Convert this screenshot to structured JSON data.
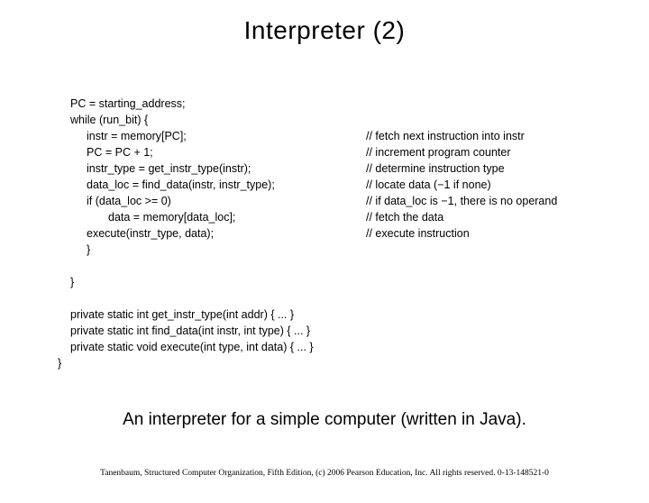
{
  "title": "Interpreter (2)",
  "code": {
    "l0": {
      "txt": "PC = starting_address;",
      "cmt": ""
    },
    "l1": {
      "txt": "while (run_bit) {",
      "cmt": ""
    },
    "l2": {
      "txt": "instr = memory[PC];",
      "cmt": "// fetch next instruction into instr"
    },
    "l3": {
      "txt": "PC = PC + 1;",
      "cmt": "// increment program counter"
    },
    "l4": {
      "txt": "instr_type = get_instr_type(instr);",
      "cmt": "// determine instruction type"
    },
    "l5": {
      "txt": "data_loc = find_data(instr, instr_type);",
      "cmt": "// locate data (−1 if none)"
    },
    "l6": {
      "txt": "if (data_loc >= 0)",
      "cmt": "// if data_loc is −1, there is no operand"
    },
    "l7": {
      "txt": "data = memory[data_loc];",
      "cmt": "// fetch the data"
    },
    "l8": {
      "txt": "execute(instr_type, data);",
      "cmt": "// execute instruction"
    },
    "l9": {
      "txt": "}",
      "cmt": ""
    },
    "blank1": {
      "txt": " ",
      "cmt": ""
    },
    "l10": {
      "txt": "}",
      "cmt": ""
    },
    "blank2": {
      "txt": " ",
      "cmt": ""
    },
    "l11": {
      "txt": "private static int get_instr_type(int addr) { ... }",
      "cmt": ""
    },
    "l12": {
      "txt": "private static int find_data(int instr, int type) { ... }",
      "cmt": ""
    },
    "l13": {
      "txt": "private static void execute(int type, int data) { ... }",
      "cmt": ""
    },
    "l14": {
      "txt": "}",
      "cmt": ""
    }
  },
  "caption": "An interpreter for a simple computer (written in Java).",
  "footer": "Tanenbaum, Structured Computer Organization, Fifth Edition, (c) 2006 Pearson Education, Inc. All rights reserved. 0-13-148521-0"
}
